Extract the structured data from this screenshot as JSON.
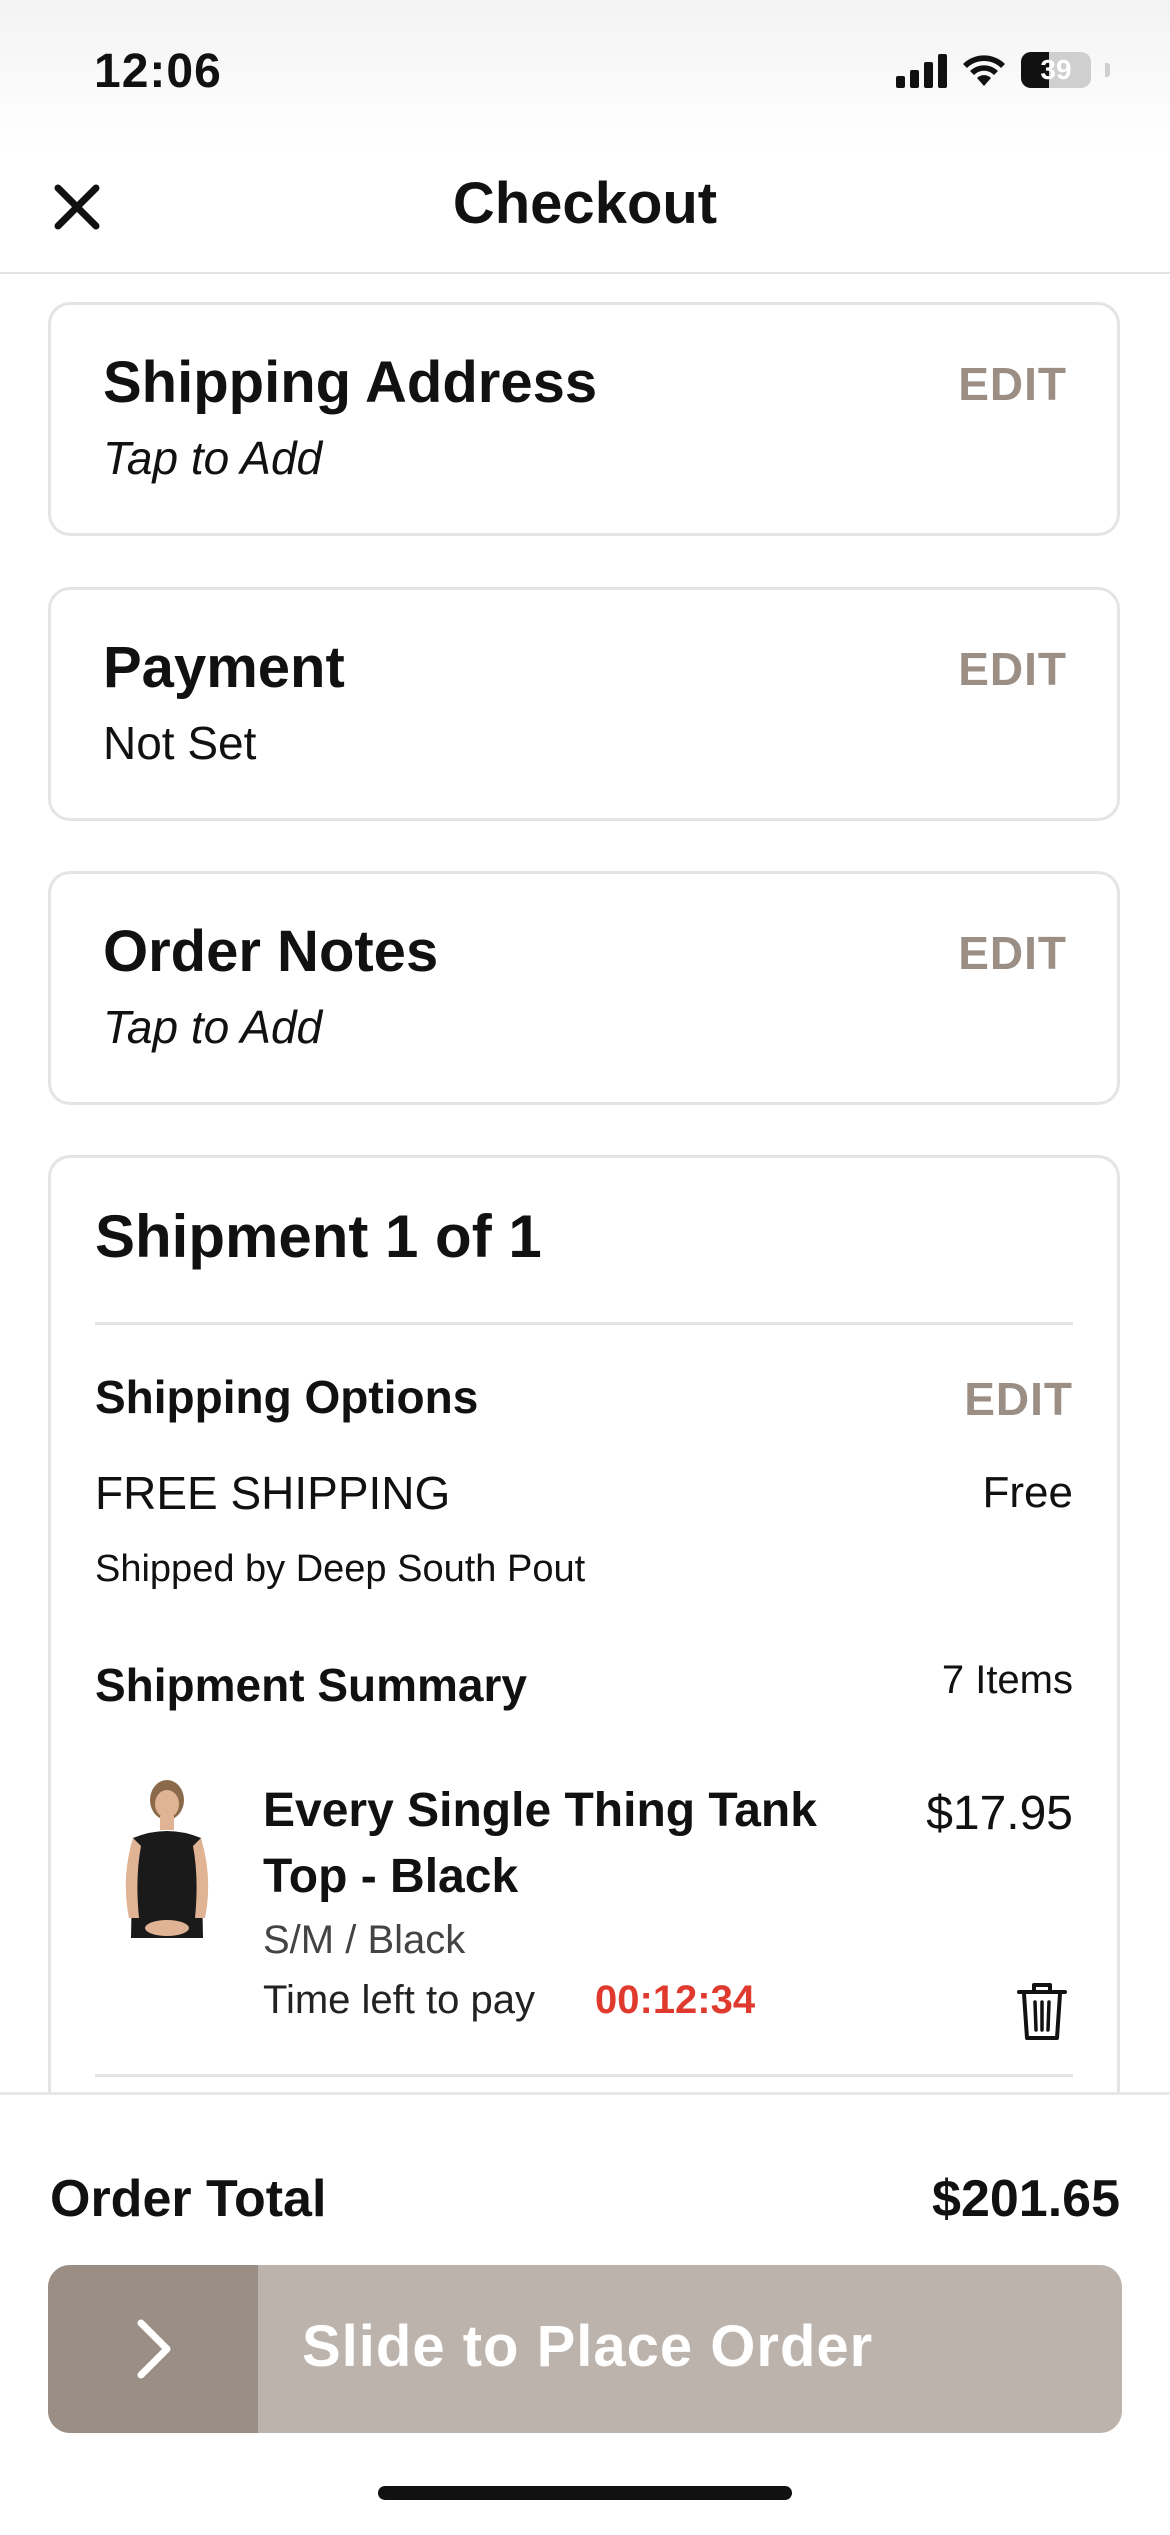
{
  "status_bar": {
    "time": "12:06",
    "battery": "39"
  },
  "nav": {
    "title": "Checkout"
  },
  "cards": {
    "shipping_address": {
      "title": "Shipping Address",
      "subtitle": "Tap to Add",
      "edit": "EDIT"
    },
    "payment": {
      "title": "Payment",
      "subtitle": "Not Set",
      "edit": "EDIT"
    },
    "order_notes": {
      "title": "Order Notes",
      "subtitle": "Tap to Add",
      "edit": "EDIT"
    }
  },
  "shipment": {
    "title": "Shipment 1 of 1",
    "shipping_options_label": "Shipping Options",
    "shipping_options_edit": "EDIT",
    "shipping_method": "FREE SHIPPING",
    "shipping_price": "Free",
    "shipped_by": "Shipped by Deep South Pout",
    "summary_label": "Shipment Summary",
    "item_count": "7 Items",
    "item": {
      "name": "Every Single Thing Tank Top - Black",
      "price": "$17.95",
      "variant": "S/M / Black",
      "time_left_label": "Time left to pay",
      "countdown": "00:12:34"
    }
  },
  "footer": {
    "total_label": "Order Total",
    "total_value": "$201.65",
    "slide_label": "Slide to Place Order"
  },
  "colors": {
    "accent": "#9b8e84",
    "slider_track": "#bdb3ad",
    "countdown_red": "#e03a2f"
  }
}
